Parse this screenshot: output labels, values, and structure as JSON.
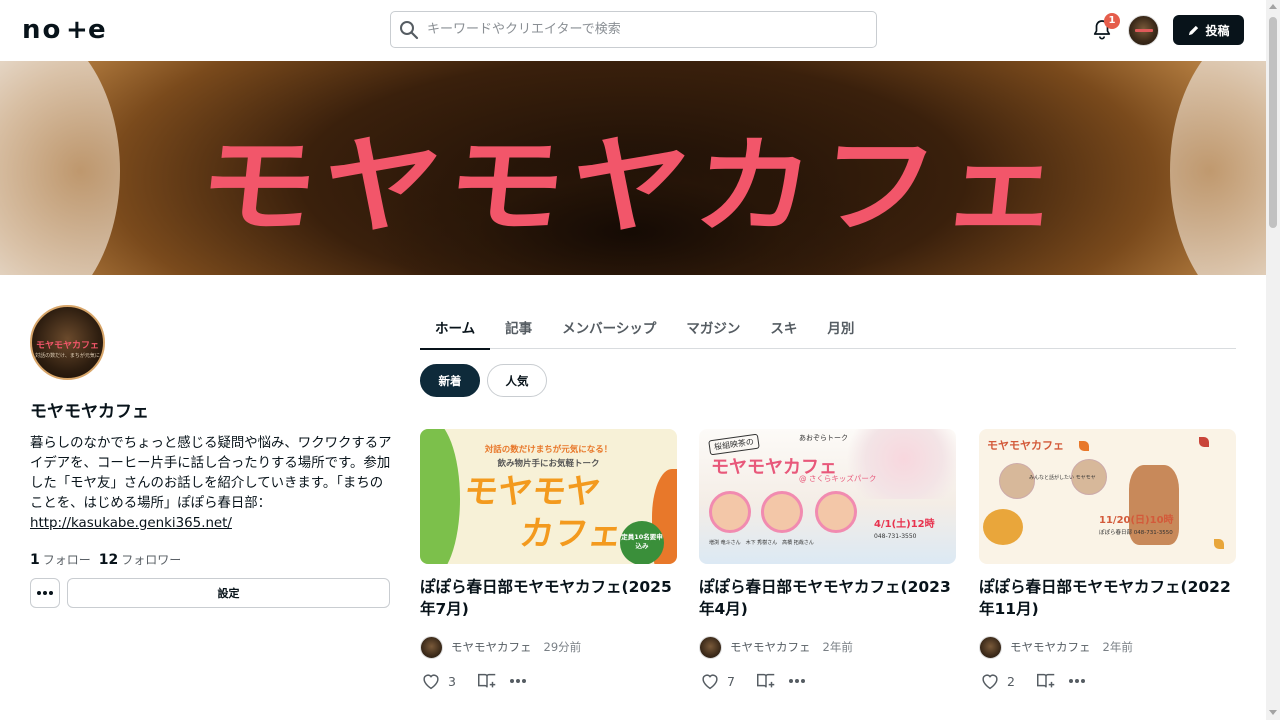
{
  "header": {
    "logo": "note",
    "search_placeholder": "キーワードやクリエイターで検索",
    "notification_count": "1",
    "post_button": "投稿"
  },
  "hero": {
    "title": "モヤモヤカフェ"
  },
  "profile": {
    "avatar_text": "モヤモヤカフェ",
    "avatar_subtext": "対話の数だけ、まちが元気に",
    "name": "モヤモヤカフェ",
    "bio": "暮らしのなかでちょっと感じる疑問や悩み、ワクワクするアイデアを、コーヒー片手に話し合ったりする場所です。参加した「モヤ友」さんのお話しを紹介していきます。「まちのことを、はじめる場所」ぽぽら春日部：",
    "link": "http://kasukabe.genki365.net/",
    "follow_count": "1",
    "follow_label": "フォロー",
    "follower_count": "12",
    "follower_label": "フォロワー",
    "settings_button": "設定"
  },
  "tabs": [
    {
      "label": "ホーム",
      "active": true
    },
    {
      "label": "記事",
      "active": false
    },
    {
      "label": "メンバーシップ",
      "active": false
    },
    {
      "label": "マガジン",
      "active": false
    },
    {
      "label": "スキ",
      "active": false
    },
    {
      "label": "月別",
      "active": false
    }
  ],
  "filters": {
    "new": "新着",
    "popular": "人気"
  },
  "cards": [
    {
      "title": "ぽぽら春日部モヤモヤカフェ(2025年7月)",
      "author": "モヤモヤカフェ",
      "time": "29分前",
      "likes": "3",
      "thumb_heading": "対話の数だけまちが元気になる！",
      "thumb_subheading": "飲み物片手にお気軽トーク",
      "thumb_big1": "モヤモヤ",
      "thumb_big2": "カフェ",
      "thumb_seal": "定員10名要申込み"
    },
    {
      "title": "ぽぽら春日部モヤモヤカフェ(2023年4月)",
      "author": "モヤモヤカフェ",
      "time": "2年前",
      "likes": "7",
      "thumb_tag": "桜組映茶の",
      "thumb_sub": "あおぞらトーク",
      "thumb_big": "モヤモヤカフェ",
      "thumb_small": "@ さくらキッズパーク",
      "thumb_date": "4/1(土)12時",
      "thumb_info": "048-731-3550",
      "thumb_names": "増渕 竜斗さん　木下 秀樹さん　高橋 拓哉さん"
    },
    {
      "title": "ぽぽら春日部モヤモヤカフェ(2022年11月)",
      "author": "モヤモヤカフェ",
      "time": "2年前",
      "likes": "2",
      "thumb_big": "モヤモヤカフェ",
      "thumb_date": "11/20(日)10時",
      "thumb_info": "ぽぽら春日部 048-731-3550",
      "thumb_names": "みんなと話がしたい モヤモヤ"
    }
  ],
  "colors": {
    "accent": "#08131a",
    "hero_title": "#f2566a",
    "badge": "#e55d4b"
  }
}
